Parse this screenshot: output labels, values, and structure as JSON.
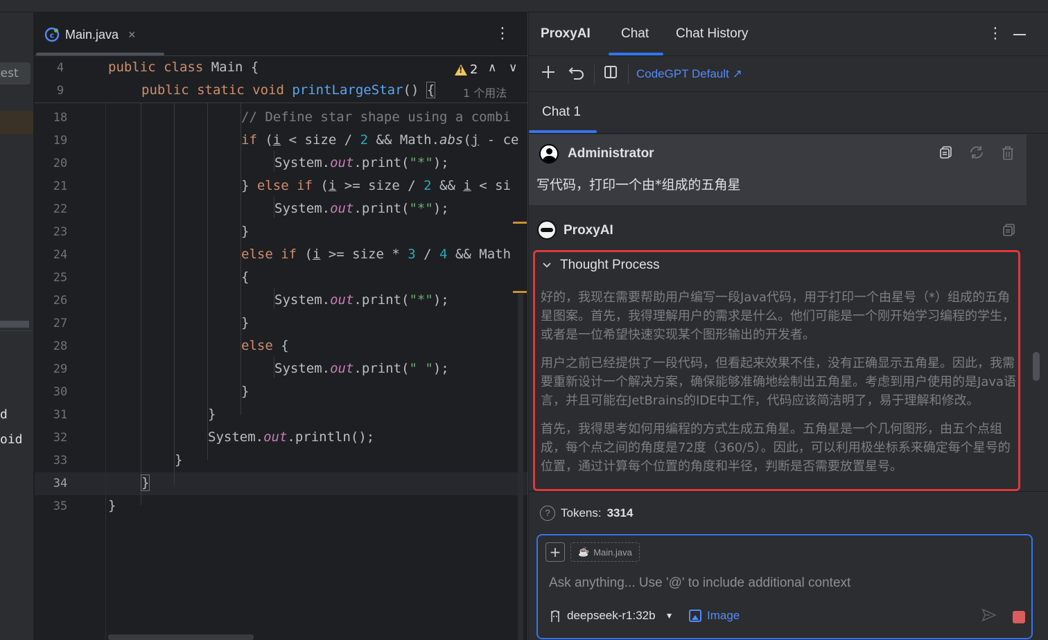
{
  "left_panel": {
    "tag": "test",
    "items": [
      "d",
      "oid"
    ]
  },
  "editor": {
    "tab_label": "Main.java",
    "tab_close": "×",
    "menu": "⋮",
    "warnings": "2",
    "usage_hint": "1 个用法",
    "lines": [
      {
        "n": "4",
        "t": "public class Main {"
      },
      {
        "n": "9",
        "t": "public static void printLargeStar() {"
      },
      {
        "n": "18",
        "t": "// Define star shape using a combi"
      },
      {
        "n": "19",
        "t": "if (i < size / 2 && Math.abs(j - ce"
      },
      {
        "n": "20",
        "t": "System.out.print(\"*\");"
      },
      {
        "n": "21",
        "t": "} else if (i >= size / 2 && i < si"
      },
      {
        "n": "22",
        "t": "System.out.print(\"*\");"
      },
      {
        "n": "23",
        "t": "}"
      },
      {
        "n": "24",
        "t": "else if (i >= size * 3 / 4 && Math"
      },
      {
        "n": "25",
        "t": "{"
      },
      {
        "n": "26",
        "t": "System.out.print(\"*\");"
      },
      {
        "n": "27",
        "t": "}"
      },
      {
        "n": "28",
        "t": "else {"
      },
      {
        "n": "29",
        "t": "System.out.print(\" \");"
      },
      {
        "n": "30",
        "t": "}"
      },
      {
        "n": "31",
        "t": "}"
      },
      {
        "n": "32",
        "t": "System.out.println();"
      },
      {
        "n": "33",
        "t": "}"
      },
      {
        "n": "34",
        "t": "}"
      },
      {
        "n": "35",
        "t": "}"
      }
    ]
  },
  "panel": {
    "title": "ProxyAI",
    "tabs": [
      "Chat",
      "Chat History"
    ],
    "active_tab": "Chat",
    "menu": "⋮",
    "model_link": "CodeGPT Default ↗",
    "chat_tab": "Chat 1",
    "user": {
      "name": "Administrator",
      "message": "写代码，打印一个由*组成的五角星"
    },
    "assistant": {
      "name": "ProxyAI",
      "thought_title": "Thought Process",
      "paragraphs": [
        "好的，我现在需要帮助用户编写一段Java代码，用于打印一个由星号（*）组成的五角星图案。首先，我得理解用户的需求是什么。他们可能是一个刚开始学习编程的学生，或者是一位希望快速实现某个图形输出的开发者。",
        "用户之前已经提供了一段代码，但看起来效果不佳，没有正确显示五角星。因此，我需要重新设计一个解决方案，确保能够准确地绘制出五角星。考虑到用户使用的是Java语言，并且可能在JetBrains的IDE中工作，代码应该简洁明了，易于理解和修改。",
        "首先，我得思考如何用编程的方式生成五角星。五角星是一个几何图形，由五个点组成，每个点之间的角度是72度（360/5）。因此，可以利用极坐标系来确定每个星号的位置，通过计算每个位置的角度和半径，判断是否需要放置星号。"
      ]
    },
    "tokens_label": "Tokens:",
    "tokens_value": "3314",
    "input": {
      "file_chip": "Main.java",
      "placeholder": "Ask anything... Use '@' to include additional context",
      "model": "deepseek-r1:32b",
      "image_label": "Image"
    }
  },
  "colors": {
    "accent": "#3574f0",
    "highlight_border": "#e0383b",
    "warning": "#f2c55c",
    "stop": "#db5c5c"
  }
}
